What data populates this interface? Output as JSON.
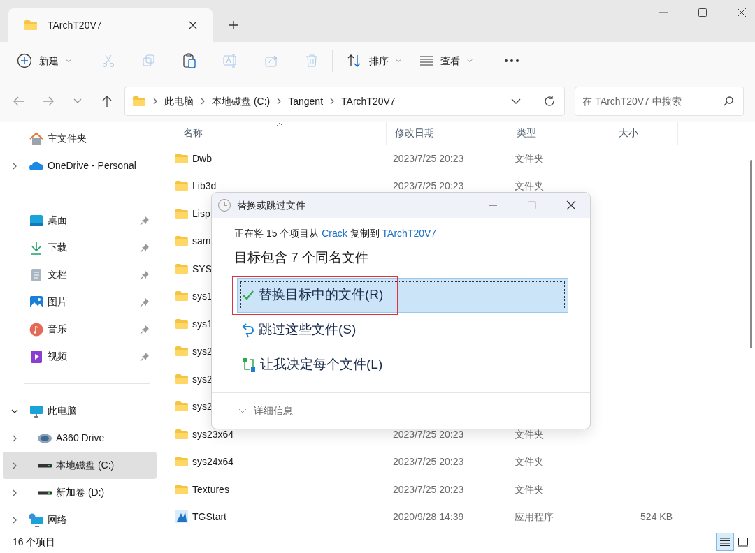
{
  "window": {
    "tabs": [
      {
        "title": "TArchT20V7",
        "selected": true
      }
    ]
  },
  "toolbar": {
    "items": [
      {
        "kind": "new",
        "label": "新建",
        "disabled": false
      },
      {
        "kind": "cut",
        "disabled": true
      },
      {
        "kind": "copy",
        "disabled": true
      },
      {
        "kind": "paste",
        "disabled": false
      },
      {
        "kind": "rename",
        "disabled": true
      },
      {
        "kind": "share",
        "disabled": true
      },
      {
        "kind": "delete",
        "disabled": true
      },
      {
        "kind": "sort",
        "label": "排序",
        "disabled": false
      },
      {
        "kind": "view",
        "label": "查看",
        "disabled": false
      },
      {
        "kind": "more",
        "disabled": false
      }
    ]
  },
  "address_bar": {
    "path": [
      "此电脑",
      "本地磁盘 (C:)",
      "Tangent",
      "TArchT20V7"
    ]
  },
  "search": {
    "placeholder": "在 TArchT20V7 中搜索"
  },
  "sidebar": {
    "sections": [
      [
        {
          "kind": "home",
          "label": "主文件夹"
        },
        {
          "kind": "cloud",
          "label": "OneDrive - Personal",
          "expanded": false
        }
      ],
      [
        {
          "kind": "desktop",
          "label": "桌面",
          "pinned": true
        },
        {
          "kind": "download",
          "label": "下载",
          "pinned": true
        },
        {
          "kind": "document",
          "label": "文档",
          "pinned": true
        },
        {
          "kind": "picture",
          "label": "图片",
          "pinned": true
        },
        {
          "kind": "music",
          "label": "音乐",
          "pinned": true
        },
        {
          "kind": "video",
          "label": "视频",
          "pinned": true
        }
      ],
      [
        {
          "kind": "pc",
          "label": "此电脑",
          "expanded": true,
          "selected": false,
          "children": [
            {
              "kind": "a360",
              "label": "A360 Drive",
              "expanded": false,
              "selected": false
            },
            {
              "kind": "drive",
              "label": "本地磁盘 (C:)",
              "expanded": false,
              "selected": true
            },
            {
              "kind": "drive",
              "label": "新加卷 (D:)",
              "expanded": false,
              "selected": false
            }
          ]
        },
        {
          "kind": "network",
          "label": "网络",
          "expanded": false,
          "selected": false
        }
      ]
    ]
  },
  "table": {
    "columns": [
      {
        "label": "名称",
        "sorted": true
      },
      {
        "label": "修改日期",
        "sorted": false
      },
      {
        "label": "类型",
        "sorted": false
      },
      {
        "label": "大小",
        "sorted": false
      }
    ],
    "rows": [
      {
        "kind": "folder",
        "name": "Dwb",
        "date": "2023/7/25 20:23",
        "type": "文件夹"
      },
      {
        "kind": "folder",
        "name": "Lib3d",
        "date": "2023/7/25 20:23",
        "type": "文件夹"
      },
      {
        "kind": "folder",
        "name": "Lisp"
      },
      {
        "kind": "folder",
        "name": "sam"
      },
      {
        "kind": "folder",
        "name": "SYS"
      },
      {
        "kind": "folder",
        "name": "sys1"
      },
      {
        "kind": "folder",
        "name": "sys1"
      },
      {
        "kind": "folder",
        "name": "sys2"
      },
      {
        "kind": "folder",
        "name": "sys2"
      },
      {
        "kind": "folder",
        "name": "sys2"
      },
      {
        "kind": "folder",
        "name": "sys23x64",
        "date": "2023/7/25 20:23",
        "type": "文件夹"
      },
      {
        "kind": "folder",
        "name": "sys24x64",
        "date": "2023/7/25 20:23",
        "type": "文件夹"
      },
      {
        "kind": "folder",
        "name": "Textures",
        "date": "2023/7/25 20:23",
        "type": "文件夹"
      },
      {
        "kind": "app",
        "name": "TGStart",
        "date": "2020/9/28 14:39",
        "type": "应用程序",
        "size": "524 KB"
      }
    ]
  },
  "status_bar": {
    "count": "16 个项目",
    "views": [
      {
        "kind": "details",
        "selected": true
      },
      {
        "kind": "tiles",
        "selected": false
      }
    ]
  },
  "dialog": {
    "title": "替换或跳过文件",
    "message": {
      "before": "正在将 15 个项目从 ",
      "source": "Crack",
      "middle": " 复制到 ",
      "destination": "TArchT20V7"
    },
    "heading": "目标包含 7 个同名文件",
    "options": [
      {
        "kind": "replace",
        "label": "替换目标中的文件(R)",
        "selected": true,
        "highlighted": true
      },
      {
        "kind": "skip",
        "label": "跳过这些文件(S)",
        "selected": false,
        "highlighted": false
      },
      {
        "kind": "decide",
        "label": "让我决定每个文件(L)",
        "selected": false,
        "highlighted": false
      }
    ],
    "details": "详细信息"
  }
}
